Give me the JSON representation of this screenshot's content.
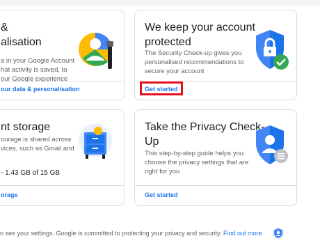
{
  "cards": {
    "personalisation": {
      "title_line1": "&",
      "title_line2": "alisation",
      "desc_line1": "a in your Google Account",
      "desc_line2": "hat activity is saved, to",
      "desc_line3": "our Google experience",
      "link": "our data & personalisation"
    },
    "security": {
      "title_line1": "We keep your account",
      "title_line2": "protected",
      "desc_line1": "The Security Check-up gives you",
      "desc_line2": "personalised recommendations to",
      "desc_line3": "secure your account",
      "link": "Get started"
    },
    "storage": {
      "title": "nt storage",
      "desc_line1": "ourage is shared across",
      "desc_line2": "vices, such as Gmail and",
      "usage": "- 1.43 GB of 15 GB",
      "link": "orage"
    },
    "privacy": {
      "title_line1": "Take the Privacy Check-",
      "title_line2": "Up",
      "desc_line1": "This step-by-step guide helps you",
      "desc_line2": "choose the privacy settings that are",
      "desc_line3": "right for you",
      "link": "Get started"
    }
  },
  "footer": {
    "text": "n see your settings. Google is committed to protecting your privacy and security.",
    "link": "Find out more"
  },
  "colors": {
    "link_blue": "#1a73e8",
    "highlight_red": "#e3101d",
    "shield_blue": "#4285f4",
    "check_green": "#34a853"
  },
  "icons": {
    "personalisation": "personalisation-illustration-icon",
    "security": "shield-lock-check-icon",
    "storage": "storage-cabinet-icon",
    "privacy": "privacy-shield-person-icon",
    "footer": "privacy-person-badge-icon"
  }
}
